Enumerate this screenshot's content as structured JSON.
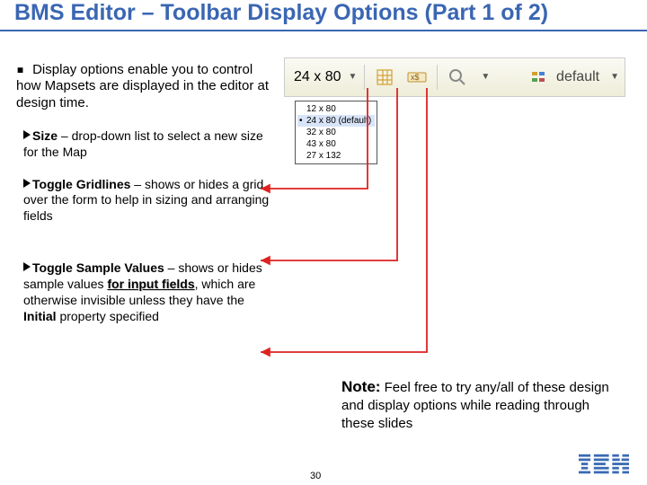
{
  "title": "BMS Editor – Toolbar Display Options (Part 1 of 2)",
  "intro_prefix": "▪ ",
  "intro": "Display options enable you to control how Mapsets are displayed in the editor at design time.",
  "bullets": [
    {
      "title": "Size",
      "body": " – drop-down list to select a new size for the Map"
    },
    {
      "title": "Toggle Gridlines",
      "body": " – shows or hides a grid over the form to help in sizing and arranging fields"
    },
    {
      "title": "Toggle Sample Values",
      "body_pre": " – shows or hides sample values ",
      "body_em": "for input fields",
      "body_post": ", which are otherwise invisible unless they have the ",
      "body_b": "Initial",
      "body_tail": " property specified"
    }
  ],
  "toolbar": {
    "size_label": "24 x 80",
    "default_label": "default"
  },
  "dropdown": {
    "items": [
      "12 x 80",
      "24 x 80 (default)",
      "32 x 80",
      "43 x 80",
      "27 x 132"
    ],
    "selected_index": 1
  },
  "note": {
    "title": "Note:",
    "body": " Feel free to try any/all of these design and display options while reading through these slides"
  },
  "page_number": "30"
}
